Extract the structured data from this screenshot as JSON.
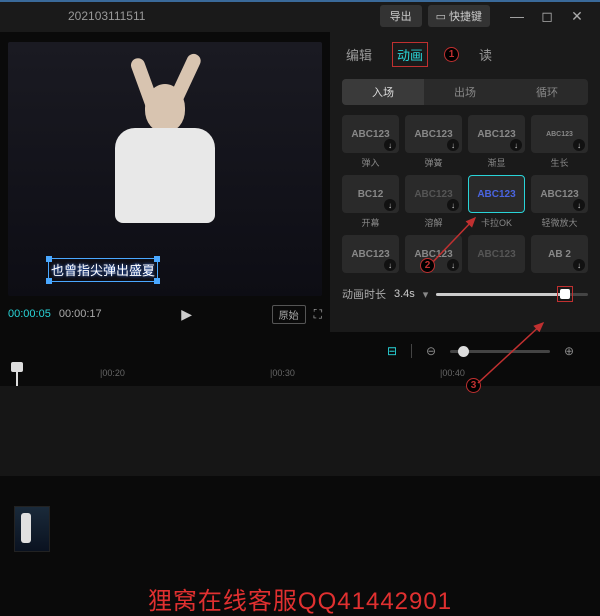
{
  "titlebar": {
    "title": "202103111511",
    "export_label": "导出",
    "shortcut_label": "快捷键"
  },
  "preview": {
    "subtitle_text": "也曾指尖弹出盛夏",
    "time_current": "00:00:05",
    "time_total": "00:00:17",
    "original_label": "原始"
  },
  "panel": {
    "tabs": {
      "edit": "编辑",
      "animation": "动画",
      "read": "读"
    },
    "subtabs": {
      "in": "入场",
      "out": "出场",
      "loop": "循环"
    },
    "duration_label": "动画时长",
    "duration_value": "3.4s"
  },
  "anim_items": [
    {
      "thumb": "ABC123",
      "label": "弹入",
      "dl": true
    },
    {
      "thumb": "ABC123",
      "label": "弹簧",
      "dl": true
    },
    {
      "thumb": "ABC123",
      "label": "渐显",
      "dl": true
    },
    {
      "thumb": "ABC123",
      "label": "生长",
      "dl": true,
      "small": true
    },
    {
      "thumb": "BC12",
      "label": "开幕",
      "dl": true
    },
    {
      "thumb": "ABC123",
      "label": "溶解",
      "dl": true,
      "faded": true
    },
    {
      "thumb": "ABC123",
      "label": "卡拉OK",
      "sel": true,
      "blue": true
    },
    {
      "thumb": "ABC123",
      "label": "轻微放大",
      "dl": true
    },
    {
      "thumb": "ABC123",
      "label": "",
      "dl": true
    },
    {
      "thumb": "ABC123",
      "label": "",
      "dl": true
    },
    {
      "thumb": "ABC123",
      "label": "",
      "faded": true
    },
    {
      "thumb": "AB  2",
      "label": "",
      "dl": true
    }
  ],
  "ruler_ticks": [
    {
      "pos": 100,
      "label": "|00:20"
    },
    {
      "pos": 270,
      "label": "|00:30"
    },
    {
      "pos": 440,
      "label": "|00:40"
    }
  ],
  "callouts": {
    "c1": "1",
    "c2": "2",
    "c3": "3"
  },
  "watermark": "狸窝在线客服QQ41442901"
}
